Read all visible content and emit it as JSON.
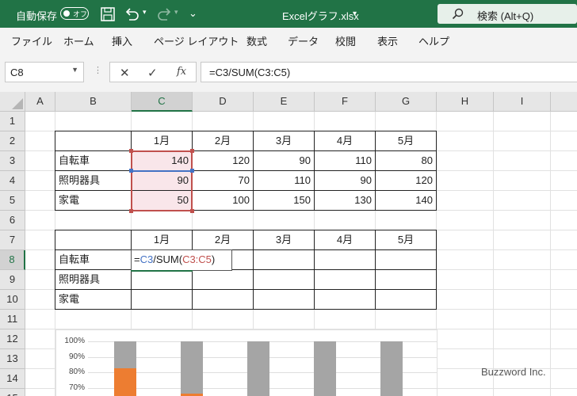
{
  "titlebar": {
    "autosave_label": "自動保存",
    "autosave_state": "オフ",
    "filename": "Excelグラフ.xlsx",
    "dropdown_glyph": "▾",
    "search_label": "検索 (Alt+Q)",
    "accent_color": "#217346"
  },
  "menu": [
    "ファイル",
    "ホーム",
    "挿入",
    "ページ レイアウト",
    "数式",
    "データ",
    "校閲",
    "表示",
    "ヘルプ"
  ],
  "formula": {
    "name_box": "C8",
    "cancel_glyph": "✕",
    "enter_glyph": "✓",
    "fx_glyph": "fx",
    "content": "=C3/SUM(C3:C5)"
  },
  "columns": [
    "A",
    "B",
    "C",
    "D",
    "E",
    "F",
    "G",
    "H",
    "I"
  ],
  "rows": [
    "1",
    "2",
    "3",
    "4",
    "5",
    "6",
    "7",
    "8",
    "9",
    "10",
    "11",
    "12",
    "13",
    "14",
    "15"
  ],
  "selected_cell": "C8",
  "table1": {
    "headers": [
      "1月",
      "2月",
      "3月",
      "4月",
      "5月"
    ],
    "rows": [
      {
        "label": "自転車",
        "values": [
          "140",
          "120",
          "90",
          "110",
          "80"
        ]
      },
      {
        "label": "照明器具",
        "values": [
          "90",
          "70",
          "110",
          "90",
          "120"
        ]
      },
      {
        "label": "家電",
        "values": [
          "50",
          "100",
          "150",
          "130",
          "140"
        ]
      }
    ]
  },
  "table2": {
    "headers": [
      "1月",
      "2月",
      "3月",
      "4月",
      "5月"
    ],
    "labels": [
      "自転車",
      "照明器具",
      "家電"
    ],
    "editing": {
      "eq": "=",
      "ref": "C3",
      "mid": "/SUM(",
      "range": "C3:C5",
      "close": ")"
    }
  },
  "chart_data": {
    "type": "bar",
    "stacked": "percent",
    "y_ticks": [
      "100%",
      "90%",
      "80%",
      "70%"
    ],
    "categories_count": 5,
    "series_colors": [
      "#ed7d31",
      "#a5a5a5"
    ],
    "visible_fill_top_pct": [
      82,
      100,
      100,
      100,
      100
    ],
    "bar2_orange_top_pct": 71
  },
  "watermark": "Buzzword Inc."
}
